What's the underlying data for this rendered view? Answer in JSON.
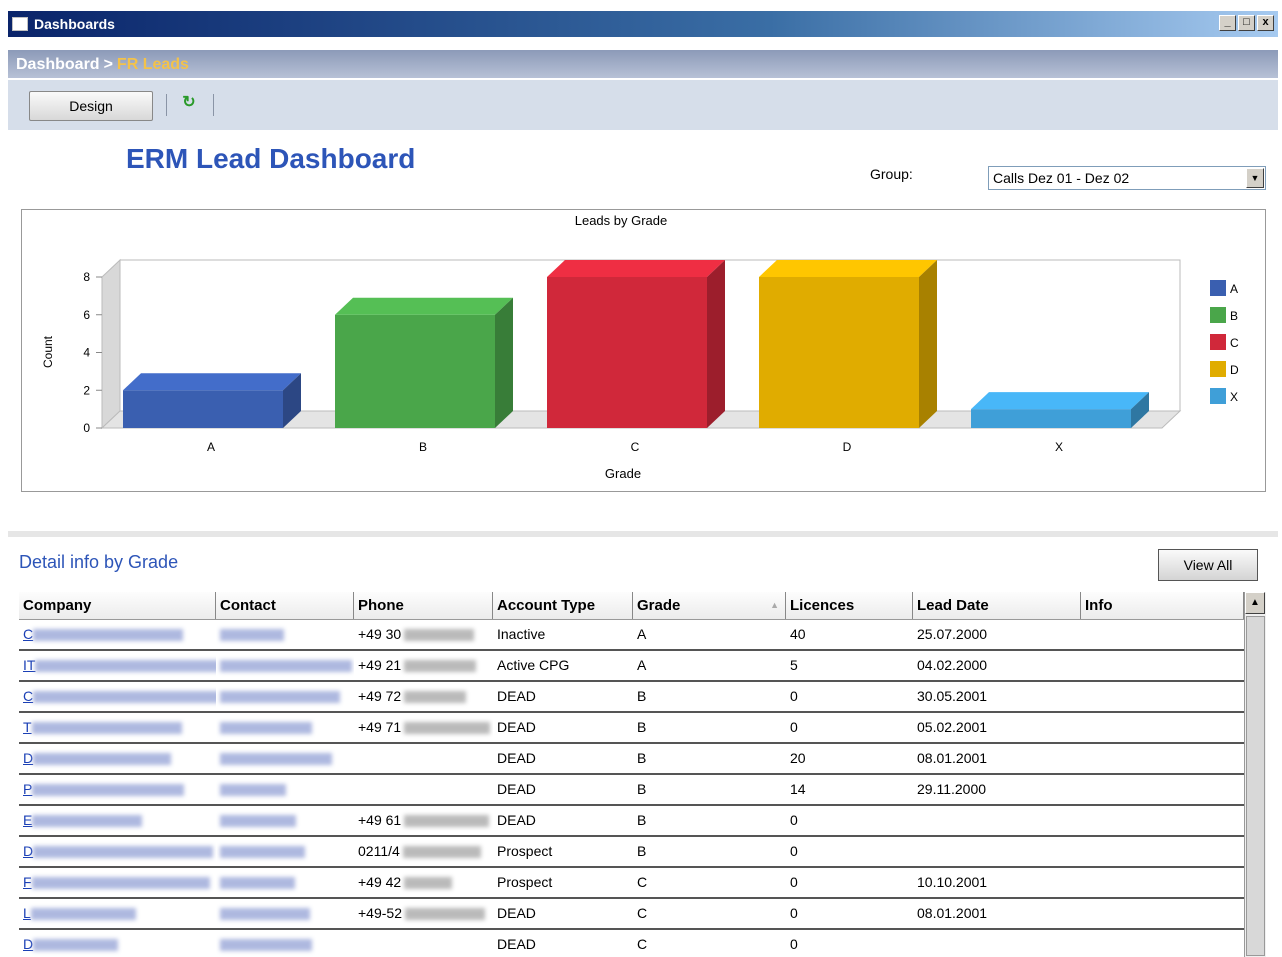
{
  "window": {
    "title": "Dashboards",
    "min": "_",
    "max": "□",
    "close": "x"
  },
  "breadcrumb": {
    "root": "Dashboard",
    "separator": ">",
    "current": "FR Leads"
  },
  "toolbar": {
    "design_label": "Design",
    "refresh_icon": "refresh-icon"
  },
  "dashboard": {
    "title": "ERM Lead Dashboard",
    "group_label": "Group:",
    "group_value": "Calls Dez 01 - Dez 02"
  },
  "chart_data": {
    "type": "bar",
    "title": "Leads by Grade",
    "xlabel": "Grade",
    "ylabel": "Count",
    "categories": [
      "A",
      "B",
      "C",
      "D",
      "X"
    ],
    "values": [
      2,
      6,
      8,
      8,
      1
    ],
    "colors": [
      "#3a5fb0",
      "#4aa64a",
      "#d0283a",
      "#e0ac00",
      "#3f9fd8"
    ],
    "yticks": [
      0,
      2,
      4,
      6,
      8
    ],
    "ylim": [
      0,
      8
    ],
    "legend": [
      "A",
      "B",
      "C",
      "D",
      "X"
    ],
    "legend_position": "right",
    "style": "3d"
  },
  "detail": {
    "title": "Detail info by Grade",
    "view_all": "View All"
  },
  "table": {
    "columns": [
      "Company",
      "Contact",
      "Phone",
      "Account Type",
      "Grade",
      "Licences",
      "Lead Date",
      "Info"
    ],
    "rows": [
      {
        "company": "C",
        "contact": "",
        "phone": "+49 30",
        "account_type": "Inactive",
        "grade": "A",
        "licences": "40",
        "lead_date": "25.07.2000",
        "info": ""
      },
      {
        "company": "IT",
        "contact": "",
        "phone": "+49 21",
        "account_type": "Active CPG",
        "grade": "A",
        "licences": "5",
        "lead_date": "04.02.2000",
        "info": ""
      },
      {
        "company": "C",
        "contact": "",
        "phone": "+49 72",
        "account_type": "DEAD",
        "grade": "B",
        "licences": "0",
        "lead_date": "30.05.2001",
        "info": ""
      },
      {
        "company": "T",
        "contact": "",
        "phone": "+49 71",
        "account_type": "DEAD",
        "grade": "B",
        "licences": "0",
        "lead_date": "05.02.2001",
        "info": ""
      },
      {
        "company": "D",
        "contact": "",
        "phone": "",
        "account_type": "DEAD",
        "grade": "B",
        "licences": "20",
        "lead_date": "08.01.2001",
        "info": ""
      },
      {
        "company": "P",
        "contact": "",
        "phone": "",
        "account_type": "DEAD",
        "grade": "B",
        "licences": "14",
        "lead_date": "29.11.2000",
        "info": ""
      },
      {
        "company": "E",
        "contact": "",
        "phone": "+49 61",
        "account_type": "DEAD",
        "grade": "B",
        "licences": "0",
        "lead_date": "",
        "info": ""
      },
      {
        "company": "D",
        "contact": "",
        "phone": "0211/4",
        "account_type": "Prospect",
        "grade": "B",
        "licences": "0",
        "lead_date": "",
        "info": ""
      },
      {
        "company": "F",
        "contact": "",
        "phone": "+49 42",
        "account_type": "Prospect",
        "grade": "C",
        "licences": "0",
        "lead_date": "10.10.2001",
        "info": ""
      },
      {
        "company": "L",
        "contact": "",
        "phone": "+49-52",
        "account_type": "DEAD",
        "grade": "C",
        "licences": "0",
        "lead_date": "08.01.2001",
        "info": ""
      },
      {
        "company": "D",
        "contact": "",
        "phone": "",
        "account_type": "DEAD",
        "grade": "C",
        "licences": "0",
        "lead_date": "",
        "info": ""
      }
    ]
  }
}
